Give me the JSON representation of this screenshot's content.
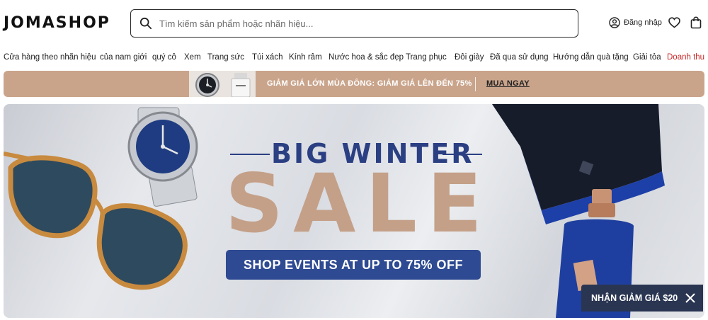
{
  "header": {
    "logo": "JOMASHOP",
    "search_placeholder": "Tìm kiếm sản phẩm hoặc nhãn hiệu...",
    "login_label": "Đăng nhập"
  },
  "nav": {
    "items": [
      "Cửa hàng theo nhãn hiệu",
      "của nam giới",
      "quý cô",
      "Xem",
      "Trang sức",
      "Túi xách",
      "Kính râm",
      "Nước hoa & sắc đẹp",
      "Trang phục",
      "Đôi giày",
      "Đã qua sử dụng",
      "Hướng dẫn quà tặng",
      "Giải tỏa",
      "Doanh thu"
    ],
    "highlight_color": "#c62828"
  },
  "promo": {
    "text": "GIẢM GIÁ LỚN MÙA ĐÔNG:  GIẢM GIÁ LÊN ĐẾN 75%",
    "cta": "MUA NGAY",
    "bg_color": "#c9a48b"
  },
  "hero": {
    "subtitle": "BIG WINTER",
    "title": "SALE",
    "cta": "SHOP EVENTS AT UP TO 75% OFF",
    "accent": "#2b3f83",
    "sale_color": "#c4a088"
  },
  "discount_chip": {
    "label": "NHẬN GIẢM GIÁ $20"
  },
  "icons": [
    "search-icon",
    "user-icon",
    "heart-icon",
    "shopping-bag-icon",
    "close-icon"
  ]
}
